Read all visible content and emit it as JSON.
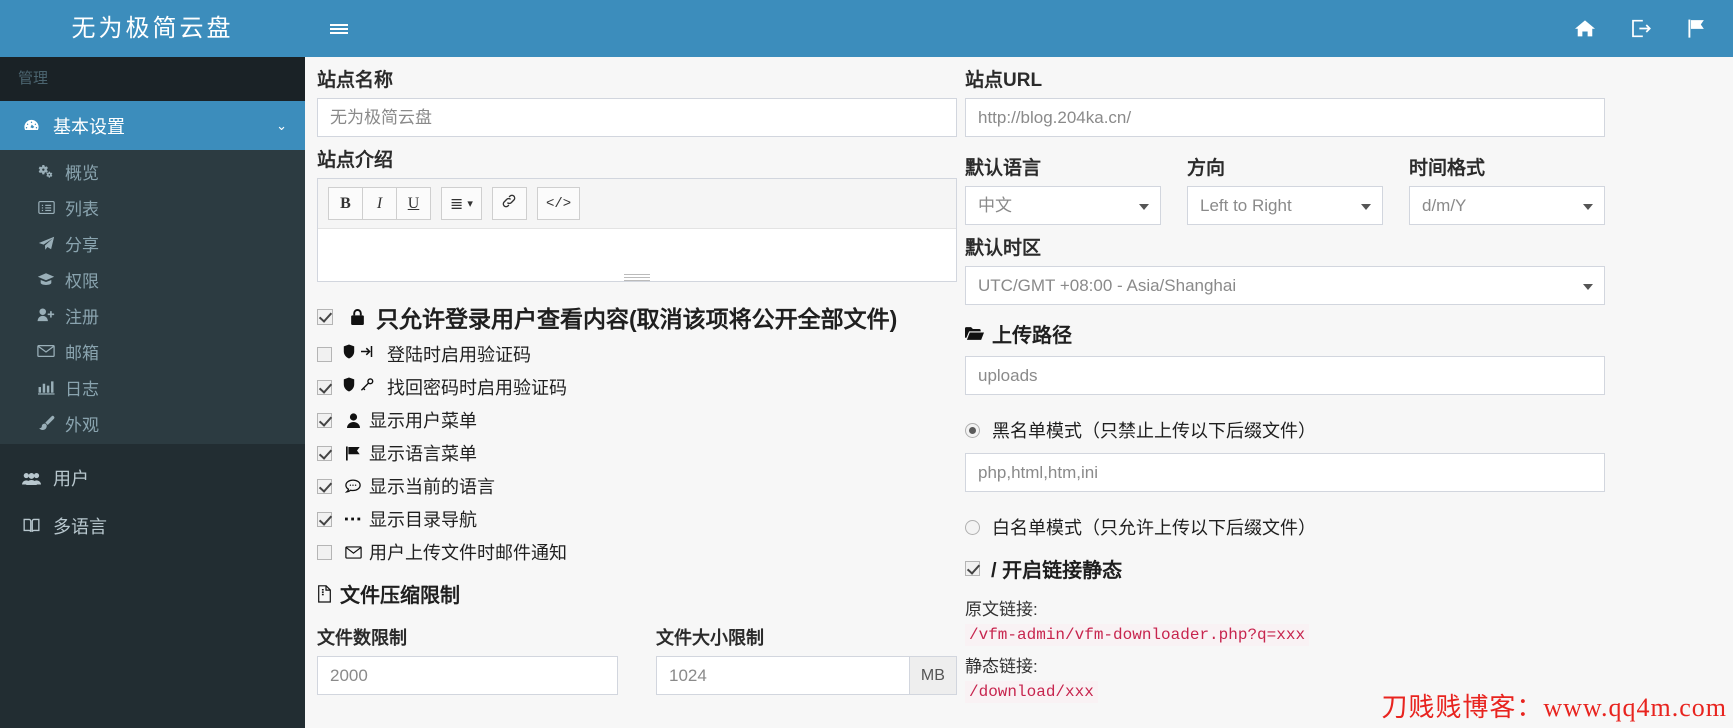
{
  "brand": {
    "title": "无为极简云盘"
  },
  "topbar": {
    "menu_toggle": "☰",
    "icons": [
      {
        "name": "home-icon",
        "glyph": ""
      },
      {
        "name": "sign-out-icon",
        "glyph": ""
      },
      {
        "name": "flag-icon",
        "glyph": ""
      }
    ]
  },
  "sidebar": {
    "header": "管理",
    "active": {
      "label": "基本设置",
      "icon": "dashboard-icon",
      "chevron": "⌄"
    },
    "sub_items": [
      {
        "label": "概览",
        "icon": "cogs-icon"
      },
      {
        "label": "列表",
        "icon": "list-alt-icon"
      },
      {
        "label": "分享",
        "icon": "paper-plane-icon"
      },
      {
        "label": "权限",
        "icon": "graduation-cap-icon"
      },
      {
        "label": "注册",
        "icon": "user-plus-icon"
      },
      {
        "label": "邮箱",
        "icon": "envelope-icon"
      },
      {
        "label": "日志",
        "icon": "bar-chart-icon"
      },
      {
        "label": "外观",
        "icon": "paint-brush-icon"
      }
    ],
    "items": [
      {
        "label": "用户",
        "icon": "users-icon"
      },
      {
        "label": "多语言",
        "icon": "book-icon"
      }
    ]
  },
  "left": {
    "site_name_label": "站点名称",
    "site_name_value": "无为极简云盘",
    "site_intro_label": "站点介绍",
    "editor": {
      "bold": "B",
      "italic": "I",
      "underline": "U",
      "align": "≣",
      "align_caret": "▾",
      "link": "link-icon",
      "code": "</>"
    },
    "checkboxes": [
      {
        "checked": true,
        "icon": "lock-icon",
        "icon2": "",
        "label": "只允许登录用户查看内容(取消该项将公开全部文件)",
        "big": true
      },
      {
        "checked": false,
        "icon": "shield-icon",
        "icon2": "sign-in-icon",
        "label": "登陆时启用验证码",
        "big": false
      },
      {
        "checked": true,
        "icon": "shield-icon",
        "icon2": "key-icon",
        "label": "找回密码时启用验证码",
        "big": false
      },
      {
        "checked": true,
        "icon": "user-icon",
        "icon2": "",
        "label": "显示用户菜单",
        "big": false
      },
      {
        "checked": true,
        "icon": "flag-icon",
        "icon2": "",
        "label": "显示语言菜单",
        "big": false
      },
      {
        "checked": true,
        "icon": "comment-icon",
        "icon2": "",
        "label": "显示当前的语言",
        "big": false
      },
      {
        "checked": true,
        "icon": "ellipsis-icon",
        "icon2": "",
        "label": "显示目录导航",
        "big": false
      },
      {
        "checked": false,
        "icon": "envelope-icon",
        "icon2": "",
        "label": "用户上传文件时邮件通知",
        "big": false
      }
    ],
    "compress_section_title": "文件压缩限制",
    "compress_section_icon": "file-archive-icon",
    "file_count_label": "文件数限制",
    "file_count_value": "2000",
    "file_size_label": "文件大小限制",
    "file_size_value": "1024",
    "file_size_unit": "MB"
  },
  "right": {
    "site_url_label": "站点URL",
    "site_url_value": "http://blog.204ka.cn/",
    "default_lang_label": "默认语言",
    "default_lang_value": "中文",
    "direction_label": "方向",
    "direction_value": "Left to Right",
    "time_format_label": "时间格式",
    "time_format_value": "d/m/Y",
    "timezone_label": "默认时区",
    "timezone_value": "UTC/GMT +08:00 - Asia/Shanghai",
    "upload_path_label": "上传路径",
    "upload_path_icon": "folder-open-icon",
    "upload_path_value": "uploads",
    "blacklist_label": "黑名单模式（只禁止上传以下后缀文件）",
    "blacklist_selected": true,
    "blacklist_value": "php,html,htm,ini",
    "whitelist_label": "白名单模式（只允许上传以下后缀文件）",
    "whitelist_selected": false,
    "static_link_checked": true,
    "static_link_label": "/ 开启链接静态",
    "original_link_caption": "原文链接:",
    "original_link_value": "/vfm-admin/vfm-downloader.php?q=xxx",
    "static_link_caption": "静态链接:",
    "static_link_value": "/download/xxx"
  },
  "watermark": {
    "text": "刀贱贱博客：www.qq4m.com"
  },
  "colors": {
    "brand_blue": "#3c8dbc",
    "sidebar_dark": "#222d32",
    "sidebar_sub": "#2c3b41",
    "sidebar_header": "#1a2226",
    "code_pink": "#c7254e",
    "watermark_red": "#e8241f"
  }
}
